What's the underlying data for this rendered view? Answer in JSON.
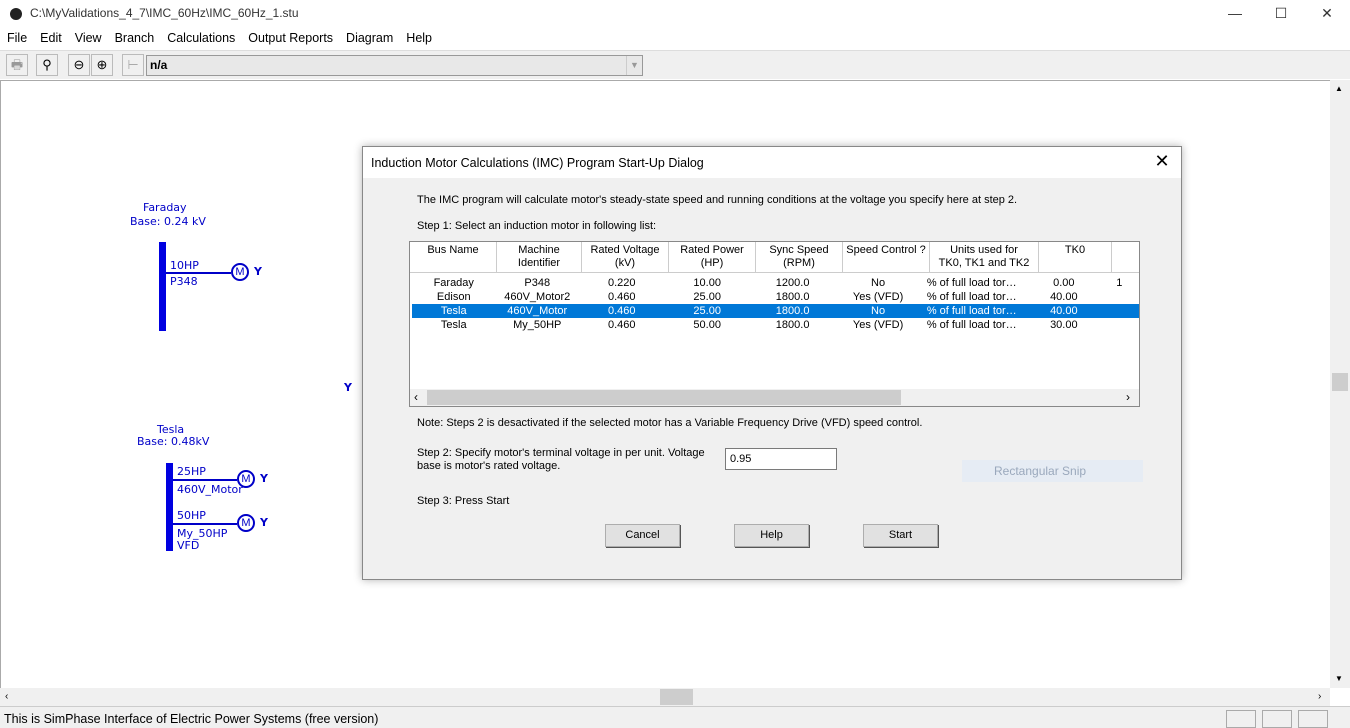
{
  "window": {
    "title": "C:\\MyValidations_4_7\\IMC_60Hz\\IMC_60Hz_1.stu",
    "minimize": "—",
    "maximize": "☐",
    "close": "✕"
  },
  "menu": [
    "File",
    "Edit",
    "View",
    "Branch",
    "Calculations",
    "Output Reports",
    "Diagram",
    "Help"
  ],
  "toolbar": {
    "combo_value": "n/a"
  },
  "diagram": {
    "faraday": {
      "name": "Faraday",
      "base": "Base: 0.24 kV",
      "motor_hp": "10HP",
      "motor_id": "P348"
    },
    "tesla": {
      "name": "Tesla",
      "base": "Base: 0.48kV",
      "motor1_hp": "25HP",
      "motor1_id": "460V_Motor",
      "motor2_hp": "50HP",
      "motor2_id": "My_50HP",
      "motor2_vfd": "VFD"
    },
    "motor_symbol": "M",
    "ground_symbol": "Y"
  },
  "ghost": {
    "snip": "Rectangular Snip"
  },
  "status": {
    "text": "This is SimPhase Interface of Electric Power Systems (free version)"
  },
  "dialog": {
    "title": "Induction Motor Calculations (IMC) Program Start-Up Dialog",
    "intro": "The IMC program will calculate motor's steady-state speed and running conditions at the voltage you specify here at step 2.",
    "step1": "Step 1: Select an induction motor in following list:",
    "columns": [
      "Bus Name",
      "Machine\nIdentifier",
      "Rated Voltage\n(kV)",
      "Rated Power\n(HP)",
      "Sync Speed\n(RPM)",
      "Speed Control ?",
      "Units used for\nTK0, TK1 and TK2",
      "TK0",
      ""
    ],
    "rows": [
      [
        "Faraday",
        "P348",
        "0.220",
        "10.00",
        "1200.0",
        "No",
        "% of full load tor…",
        "0.00",
        "1"
      ],
      [
        "Edison",
        "460V_Motor2",
        "0.460",
        "25.00",
        "1800.0",
        "Yes (VFD)",
        "% of full load tor…",
        "40.00",
        ""
      ],
      [
        "Tesla",
        "460V_Motor",
        "0.460",
        "25.00",
        "1800.0",
        "No",
        "% of full load tor…",
        "40.00",
        ""
      ],
      [
        "Tesla",
        "My_50HP",
        "0.460",
        "50.00",
        "1800.0",
        "Yes (VFD)",
        "% of full load tor…",
        "30.00",
        ""
      ]
    ],
    "selected_row": 2,
    "note": "Note: Steps 2 is desactivated if the selected motor has a Variable Frequency Drive (VFD) speed control.",
    "step2": "Step 2: Specify motor's terminal voltage in per unit. Voltage base is motor's rated voltage.",
    "voltage_value": "0.95",
    "step3": "Step 3: Press Start",
    "cancel": "Cancel",
    "help": "Help",
    "start": "Start"
  }
}
